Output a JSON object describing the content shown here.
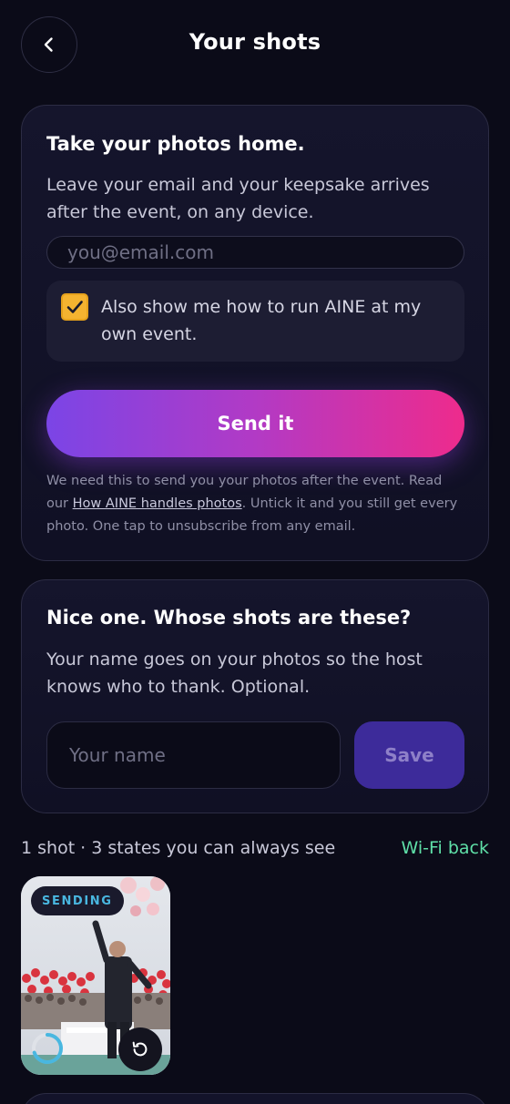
{
  "header": {
    "title": "Your shots",
    "back_icon": "chevron-left-icon"
  },
  "email_card": {
    "title": "Take your photos home.",
    "subtitle": "Leave your email and your keepsake arrives after the event, on any device.",
    "email_placeholder": "you@email.com",
    "email_value": "",
    "opt_in_checked": true,
    "opt_in_label": "Also show me how to run AINE at my own event.",
    "send_label": "Send it",
    "fine_print_before": "We need this to send you your photos after the event. Read our ",
    "fine_print_link": "How AINE handles photos",
    "fine_print_after": ". Untick it and you still get every photo. One tap to unsubscribe from any email."
  },
  "name_card": {
    "title": "Nice one. Whose shots are these?",
    "subtitle": "Your name goes on your photos so the host knows who to thank. Optional.",
    "name_placeholder": "Your name",
    "name_value": "",
    "save_label": "Save"
  },
  "shots": {
    "summary": "1 shot · 3 states you can always see",
    "connection_status": "Wi-Fi back",
    "items": [
      {
        "status_badge": "SENDING",
        "progress": 0.7,
        "retry_icon": "retry-icon"
      }
    ]
  },
  "colors": {
    "background": "#0b0b18",
    "accent_gradient_start": "#7b45e6",
    "accent_gradient_end": "#ee2b8c",
    "checkbox": "#f4b330",
    "wifi_status": "#5fe0a8",
    "sending_badge": "#49b7e0",
    "save_button": "#3d2b9a"
  }
}
